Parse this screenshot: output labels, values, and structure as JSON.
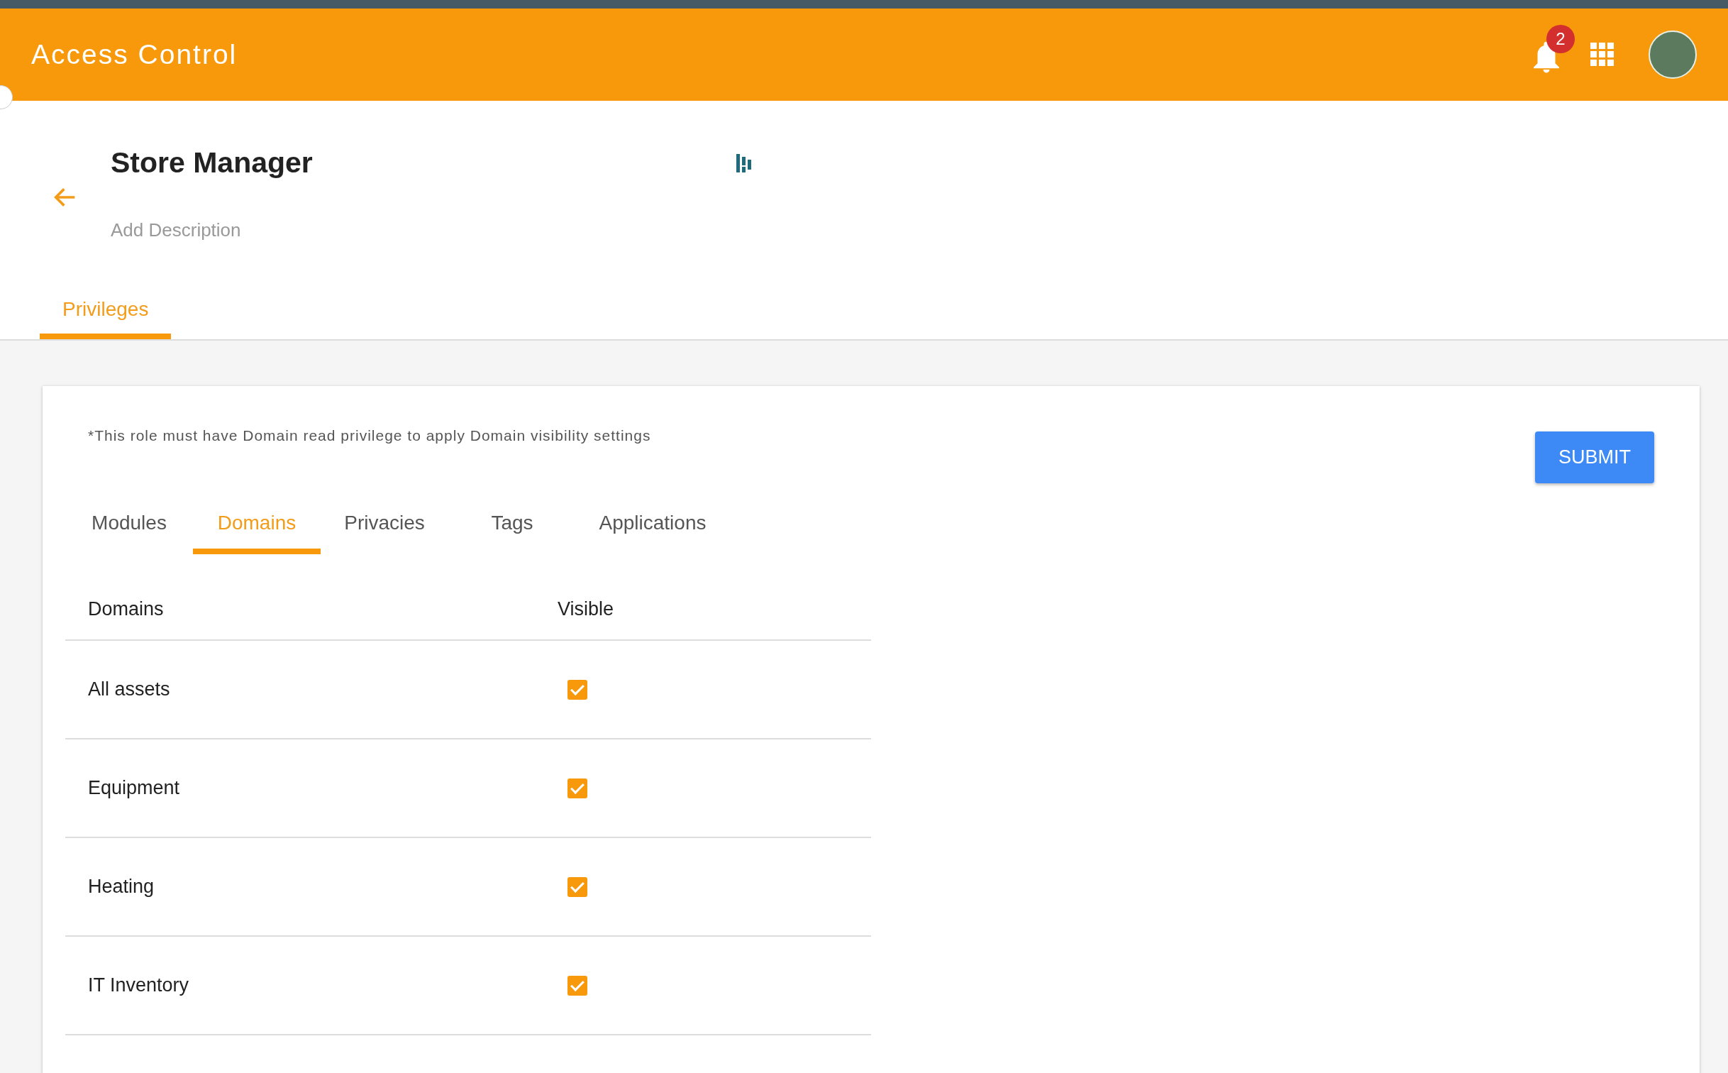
{
  "app_bar": {
    "title": "Access Control",
    "notifications": "2"
  },
  "role": {
    "name": "Store Manager",
    "description": {
      "placeholder": "Add Description"
    }
  },
  "page_tabs": [
    {
      "label": "Privileges",
      "selected": true
    }
  ],
  "note": "*This role must have Domain read privilege to apply Domain visibility settings",
  "submit_button": "SUBMIT",
  "tabs": [
    {
      "label": "Modules",
      "selected": false
    },
    {
      "label": "Domains",
      "selected": true
    },
    {
      "label": "Privacies",
      "selected": false
    },
    {
      "label": "Tags",
      "selected": false
    },
    {
      "label": "Applications",
      "selected": false
    }
  ],
  "table": {
    "columns": [
      "Domains",
      "Visible"
    ],
    "rows": [
      {
        "domain": "All assets",
        "visible": true
      },
      {
        "domain": "Equipment",
        "visible": true
      },
      {
        "domain": "Heating",
        "visible": true
      },
      {
        "domain": "IT Inventory",
        "visible": true
      }
    ]
  }
}
